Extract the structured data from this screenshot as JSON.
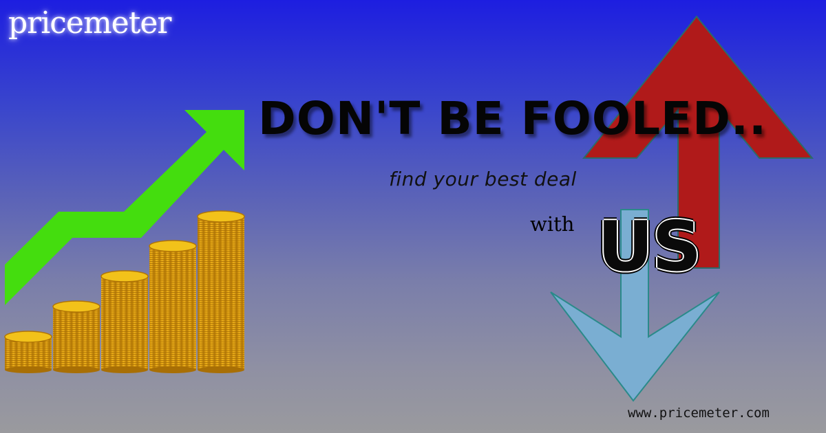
{
  "brand": {
    "logo_text": "pricemeter",
    "url_text": "www.pricemeter.com"
  },
  "headline": "DON'T BE FOOLED..",
  "tagline": "find your best deal",
  "with_text": "with",
  "us_text": "US",
  "colors": {
    "background_top": "#1d1ee0",
    "background_bottom": "#9a9a9e",
    "growth_arrow": "#44dd0e",
    "up_arrow": "#b01a1a",
    "down_arrow": "#7aaed2",
    "coin_gold": "#e6a80c"
  },
  "icons": [
    "growth-arrow-icon",
    "coin-stacks-icon",
    "up-arrow-icon",
    "down-arrow-icon"
  ]
}
